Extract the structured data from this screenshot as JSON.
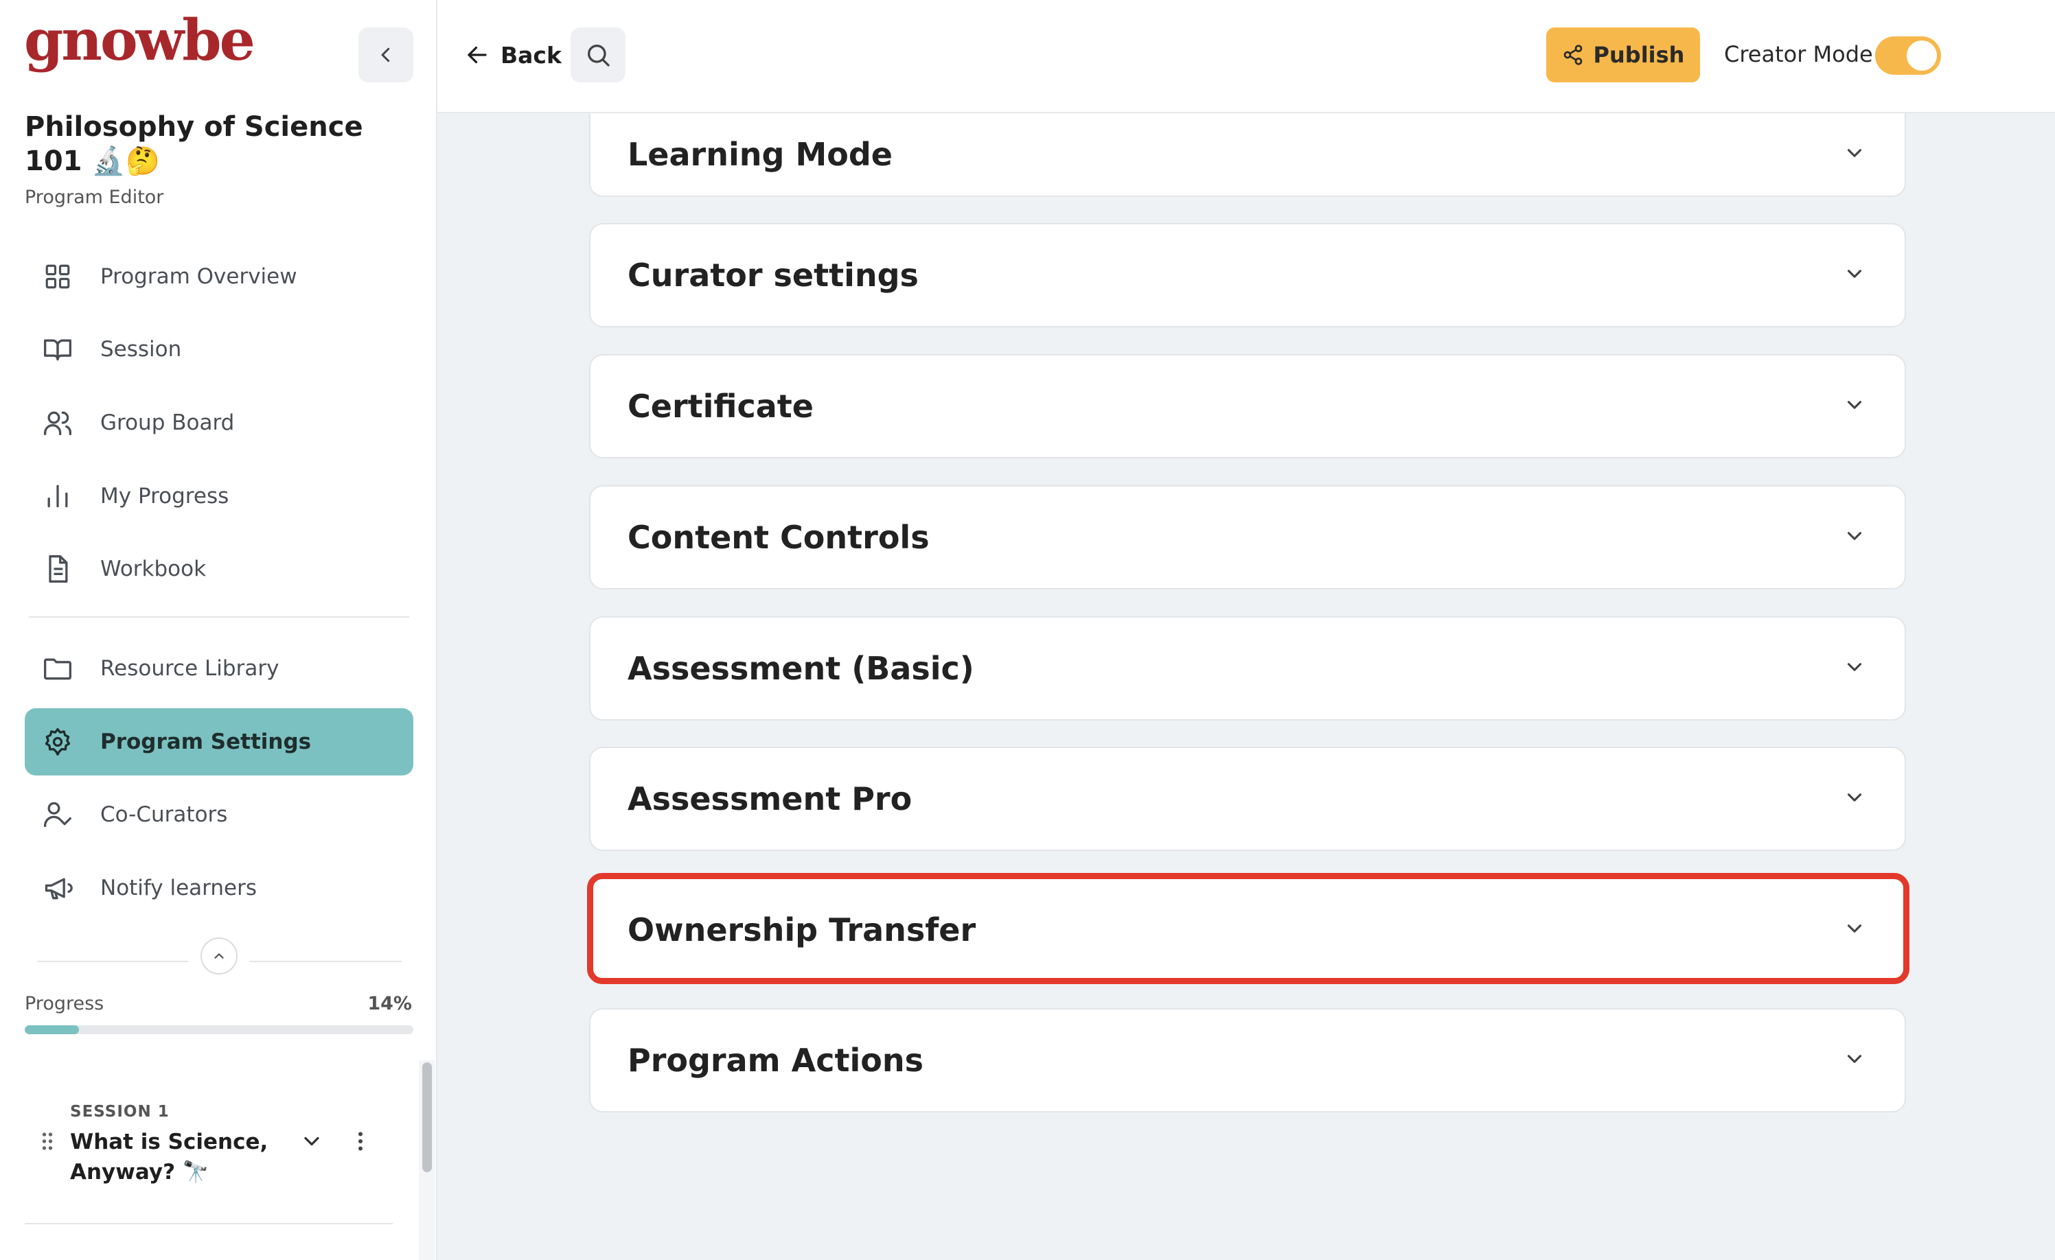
{
  "brand": {
    "logo_text": "gnowbe"
  },
  "sidebar": {
    "program_title": "Philosophy of Science 101 🔬🤔",
    "program_subtitle": "Program Editor",
    "nav": [
      {
        "label": "Program Overview",
        "icon": "grid-icon"
      },
      {
        "label": "Session",
        "icon": "book-open-icon"
      },
      {
        "label": "Group Board",
        "icon": "users-icon"
      },
      {
        "label": "My Progress",
        "icon": "bar-chart-icon"
      },
      {
        "label": "Workbook",
        "icon": "document-icon"
      },
      {
        "label": "Resource Library",
        "icon": "folder-icon"
      },
      {
        "label": "Program Settings",
        "icon": "gear-icon",
        "active": true
      },
      {
        "label": "Co-Curators",
        "icon": "user-check-icon"
      },
      {
        "label": "Notify learners",
        "icon": "megaphone-icon"
      }
    ],
    "progress": {
      "label": "Progress",
      "percent_text": "14%",
      "value": 0.14
    },
    "sessions": [
      {
        "kicker": "SESSION 1",
        "title": "What is Science, Anyway? 🔭"
      }
    ]
  },
  "topbar": {
    "back_label": "Back",
    "publish_label": "Publish",
    "creator_mode_label": "Creator Mode",
    "creator_mode_on": true
  },
  "settings_sections": [
    {
      "title": "Learning Mode"
    },
    {
      "title": "Curator settings"
    },
    {
      "title": "Certificate"
    },
    {
      "title": "Content Controls"
    },
    {
      "title": "Assessment (Basic)"
    },
    {
      "title": "Assessment Pro"
    },
    {
      "title": "Ownership Transfer",
      "highlighted": true
    },
    {
      "title": "Program Actions"
    }
  ],
  "colors": {
    "brand_red": "#a8272b",
    "accent_teal": "#7cc1c1",
    "publish_yellow": "#f7b84b",
    "highlight_red": "#e2392b"
  }
}
